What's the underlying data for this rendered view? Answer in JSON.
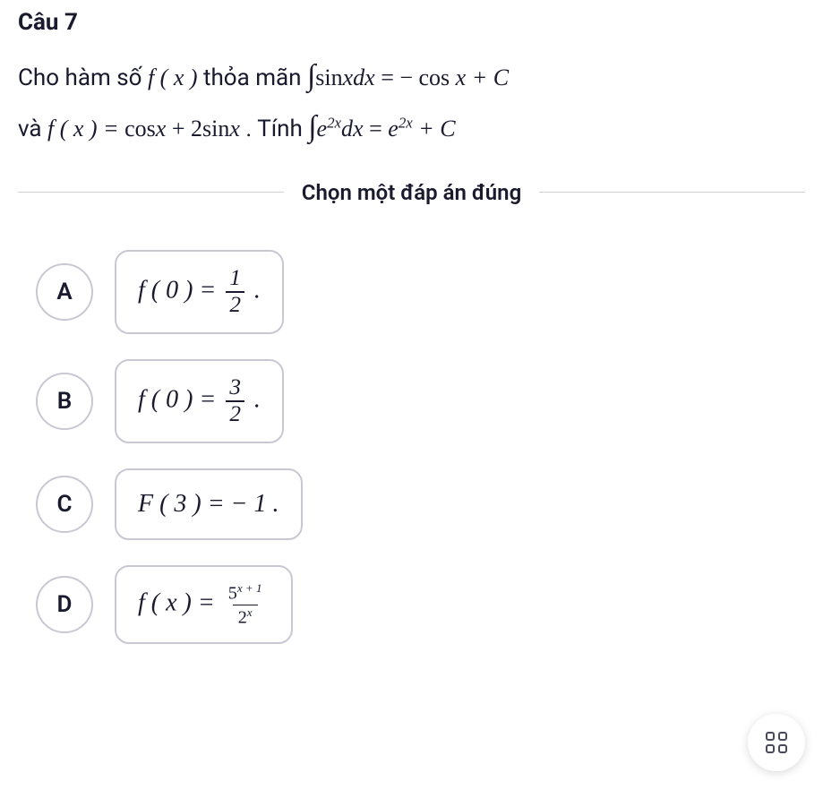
{
  "question": {
    "number": "Câu 7",
    "text_part1": "Cho hàm số ",
    "fx": "f ( x )",
    "text_part2": " thỏa mãn ",
    "eq1_prefix": "sin",
    "eq1_var": "x",
    "eq1_dx": "dx",
    "eq1_equals": " = − cos ",
    "eq1_x": "x",
    "eq1_plus_c": " + C",
    "text_part3": "và ",
    "fx2": "f ( x ) = ",
    "eq2_cos": " cos",
    "eq2_x1": "x",
    "eq2_plus": " + 2sin",
    "eq2_x2": "x",
    "text_part4": ". Tính ",
    "eq3_e": "e",
    "eq3_exp": "2x",
    "eq3_dx": "dx",
    "eq3_equals": " = ",
    "eq3_e2": "e",
    "eq3_exp2": "2x",
    "eq3_plus_c": " + C"
  },
  "instruction": "Chọn một đáp án đúng",
  "options": {
    "A": {
      "letter": "A",
      "prefix": "f ( 0 ) = ",
      "num": "1",
      "den": "2",
      "suffix": " ."
    },
    "B": {
      "letter": "B",
      "prefix": "f ( 0 ) = ",
      "num": "3",
      "den": "2",
      "suffix": " ."
    },
    "C": {
      "letter": "C",
      "text": "F ( 3 ) = − 1 ."
    },
    "D": {
      "letter": "D",
      "prefix": "f ( x ) = ",
      "num_base": "5",
      "num_exp": "x + 1",
      "den_base": "2",
      "den_exp": "x"
    }
  }
}
